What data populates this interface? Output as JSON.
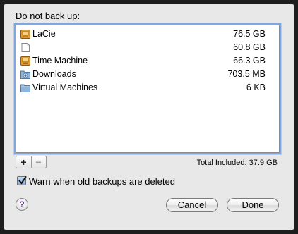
{
  "dialog": {
    "heading": "Do not back up:",
    "total_label": "Total Included: 37.9 GB",
    "add_label": "+",
    "remove_label": "−",
    "checkbox": {
      "label": "Warn when old backups are deleted",
      "checked": true
    },
    "help_label": "?",
    "cancel_label": "Cancel",
    "done_label": "Done"
  },
  "items": [
    {
      "name": "LaCie",
      "size": "76.5 GB",
      "icon": "external-drive-icon"
    },
    {
      "name": "",
      "size": "60.8 GB",
      "icon": "blank-drive-icon"
    },
    {
      "name": "Time Machine",
      "size": "66.3 GB",
      "icon": "external-drive-icon"
    },
    {
      "name": "Downloads",
      "size": "703.5 MB",
      "icon": "downloads-folder-icon"
    },
    {
      "name": "Virtual Machines",
      "size": "6 KB",
      "icon": "folder-icon"
    }
  ],
  "colors": {
    "window_background": "#e8e8e8",
    "focus_ring": "#7fa6e0",
    "checkbox_fill": "#7aa9e3",
    "drive_icon": "#e89b2a",
    "folder_icon": "#8fb4da"
  }
}
